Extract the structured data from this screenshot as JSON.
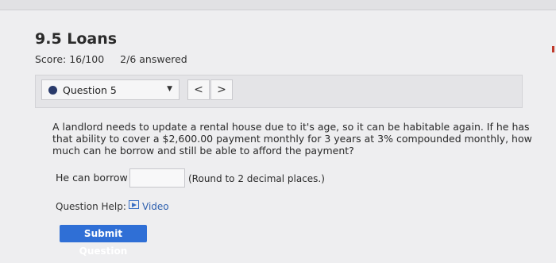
{
  "header": {
    "title": "9.5 Loans",
    "score": "Score: 16/100",
    "answered": "2/6 answered"
  },
  "question_nav": {
    "selected": "Question 5",
    "prev": "<",
    "next": ">"
  },
  "question": {
    "text": "A landlord needs to update a rental house due to it's age, so it can be habitable again. If he has that ability to cover a $2,600.00 payment monthly for 3 years at 3% compounded monthly, how much can he borrow and still be able to afford the payment?",
    "borrow_label": "He can borrow $",
    "answer_value": "",
    "round_note": "(Round to 2 decimal places.)"
  },
  "help": {
    "label": "Question Help:",
    "video": "Video"
  },
  "submit_label": "Submit Question",
  "colors": {
    "accent": "#2f6fd6",
    "dot": "#2a3b6b"
  }
}
